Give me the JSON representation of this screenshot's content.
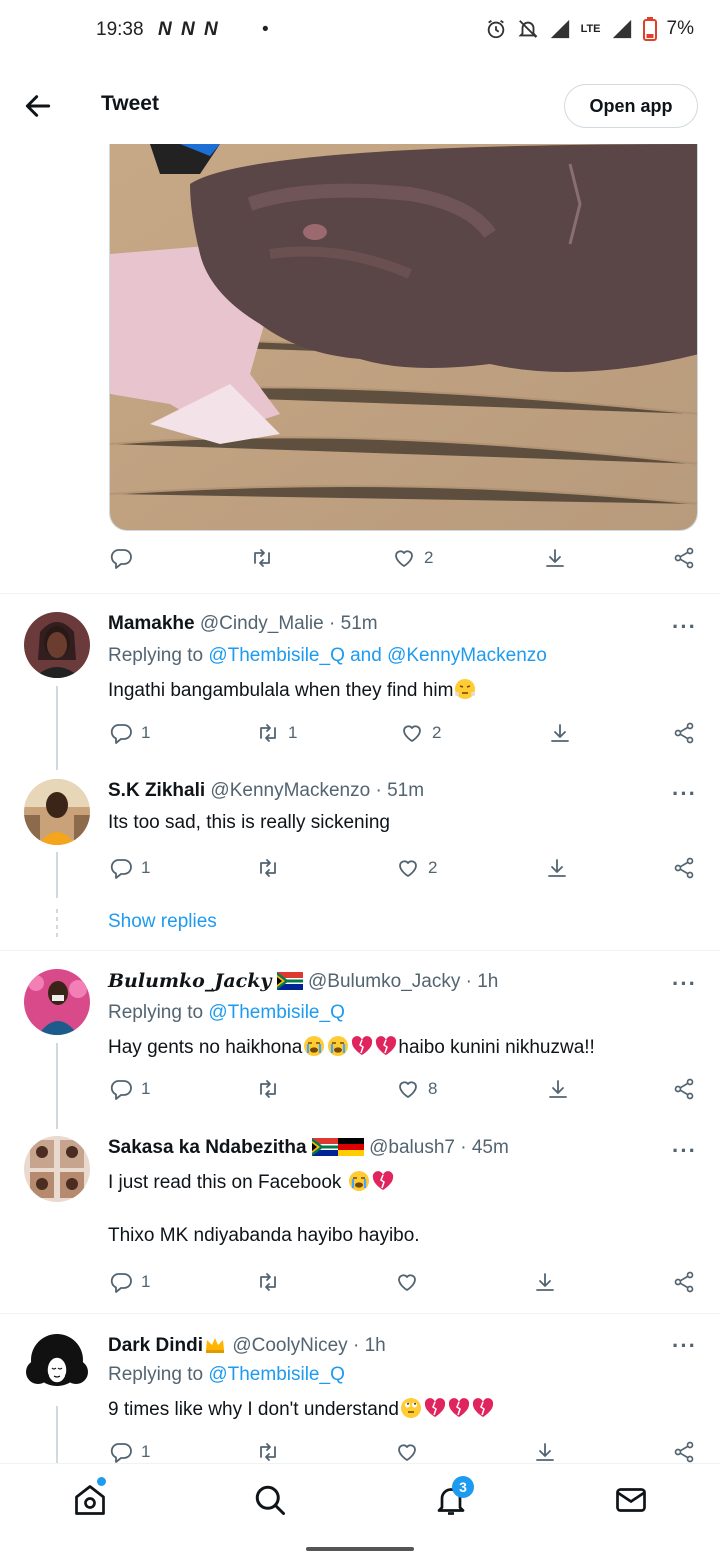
{
  "status_bar": {
    "time": "19:38",
    "network_icons": "N N N",
    "dot": "•",
    "battery": "7%",
    "network_type": "LTE"
  },
  "header": {
    "back_icon": "arrow-left-icon",
    "title": "Tweet",
    "open_app": "Open app"
  },
  "main_tweet": {
    "likes": "2",
    "image": "photo of an injured hand on a wooden surface"
  },
  "replies": [
    {
      "name": "Mamakhe",
      "handle": "@Cindy_Malie",
      "time": "· 51m",
      "replying_prefix": "Replying to",
      "replying_to": "@Thembisile_Q and @KennyMackenzo",
      "text": "Ingathi bangambulala when they find him",
      "reply_count": "1",
      "retweet_count": "1",
      "like_count": "2"
    },
    {
      "name": "S.K Zikhali",
      "handle": "@KennyMackenzo",
      "time": "· 51m",
      "text": "Its too sad, this is really sickening",
      "reply_count": "1",
      "retweet_count": "",
      "like_count": "2",
      "show_replies": "Show replies"
    },
    {
      "name": "Bulumko_Jacky",
      "handle": "@Bulumko_Jacky",
      "time": "· 1h",
      "replying_prefix": "Replying to",
      "replying_to": "@Thembisile_Q",
      "text_a": "Hay gents no haikhona",
      "text_b": "haibo kunini nikhuzwa!!",
      "reply_count": "1",
      "retweet_count": "",
      "like_count": "8"
    },
    {
      "name": "Sakasa ka Ndabezitha",
      "handle": "@balush7",
      "time": "· 45m",
      "text_a": "I just read this on Facebook",
      "text_b": "Thixo MK ndiyabanda hayibo hayibo.",
      "reply_count": "1",
      "retweet_count": "",
      "like_count": ""
    },
    {
      "name": "Dark Dindi",
      "handle": "@CoolyNicey",
      "time": "· 1h",
      "replying_prefix": "Replying to",
      "replying_to": "@Thembisile_Q",
      "text": "9 times like why I don't understand",
      "reply_count": "1",
      "retweet_count": "",
      "like_count": ""
    }
  ],
  "more_glyph": "···",
  "bottom_nav": {
    "home_icon": "home-icon",
    "search_icon": "search-icon",
    "notifications_icon": "bell-icon",
    "notifications_badge": "3",
    "messages_icon": "mail-icon"
  },
  "colors": {
    "accent": "#1d9bf0",
    "muted": "#536471",
    "text": "#0f1419"
  }
}
